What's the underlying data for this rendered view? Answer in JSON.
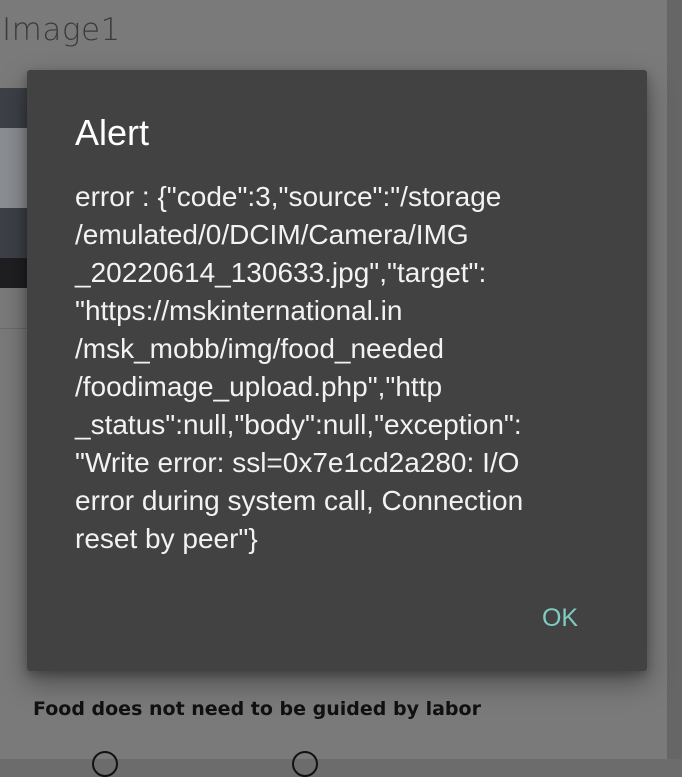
{
  "background": {
    "title": "Image1",
    "label": "Food does not need to be guided by labor"
  },
  "dialog": {
    "title": "Alert",
    "message_lines": [
      "error : {\"code\":3,\"source\":\"/storage",
      "/emulated/0/DCIM/Camera/IMG",
      "_20220614_130633.jpg\",\"target\":",
      "\"https://mskinternational.in",
      "/msk_mobb/img/food_needed",
      "/foodimage_upload.php\",\"http",
      "_status\":null,\"body\":null,\"exception\":",
      "\"Write error: ssl=0x7e1cd2a280: I/O",
      "error during system call, Connection",
      "reset by peer\"}"
    ],
    "ok_label": "OK"
  },
  "colors": {
    "dialog_bg": "#424242",
    "accent": "#80cbc4",
    "scrim": "#6c6c6c"
  }
}
